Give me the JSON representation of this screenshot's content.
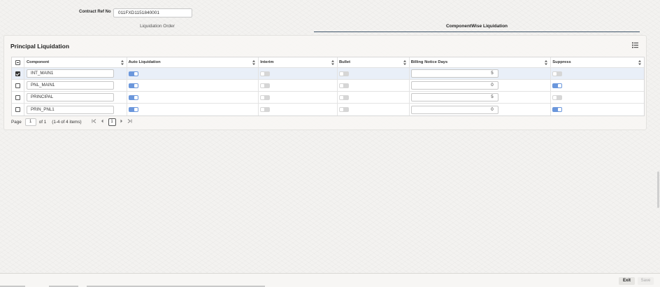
{
  "header": {
    "contract_ref_label": "Contract Ref No",
    "contract_ref_value": "011FXD1151840001"
  },
  "tabs": [
    {
      "label": "Liquidation Order",
      "active": false
    },
    {
      "label": "ComponentWise Liquidation",
      "active": true
    }
  ],
  "section": {
    "title": "Principal Liquidation"
  },
  "grid": {
    "columns": [
      "Component",
      "Auto Liquidation",
      "Interim",
      "Bullet",
      "Billing Notice Days",
      "Suppress"
    ],
    "rows": [
      {
        "selected": true,
        "component": "INT_MAIN1",
        "auto_liquidation": true,
        "interim": false,
        "bullet": false,
        "billing_notice_days": "5",
        "suppress": false
      },
      {
        "selected": false,
        "component": "PNL_MAIN1",
        "auto_liquidation": true,
        "interim": false,
        "bullet": false,
        "billing_notice_days": "0",
        "suppress": true
      },
      {
        "selected": false,
        "component": "PRINCIPAL",
        "auto_liquidation": true,
        "interim": false,
        "bullet": false,
        "billing_notice_days": "5",
        "suppress": false
      },
      {
        "selected": false,
        "component": "PRIN_PNL1",
        "auto_liquidation": true,
        "interim": false,
        "bullet": false,
        "billing_notice_days": "0",
        "suppress": true
      }
    ]
  },
  "pager": {
    "page_label": "Page",
    "page_value": "1",
    "of_label": "of 1",
    "items_label": "(1-4 of 4 items)",
    "current_page": "1"
  },
  "footer": {
    "exit_label": "Exit",
    "save_label": "Save"
  },
  "colors": {
    "accent": "#6b97dc",
    "tab_underline": "#40566a"
  },
  "icons": {
    "first": "⏮",
    "prev": "‹",
    "next": "›",
    "last": "⏭"
  }
}
